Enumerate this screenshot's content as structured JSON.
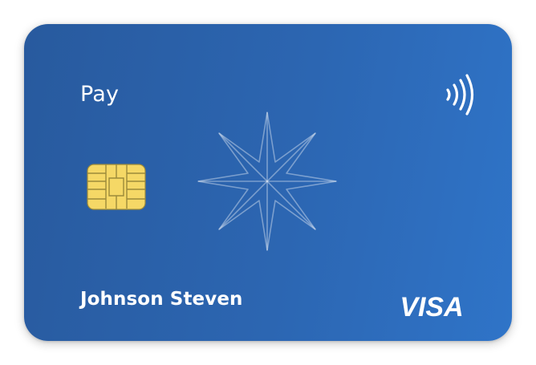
{
  "card": {
    "brand_label": "Pay",
    "holder_name": "Johnson Steven",
    "network": "VISA",
    "icons": {
      "contactless": "contactless-icon",
      "chip": "chip-icon",
      "emblem": "star-emblem-icon",
      "network_logo": "visa-logo"
    },
    "colors": {
      "card_start": "#285a9e",
      "card_end": "#2f74c8",
      "chip": "#f5d866",
      "text": "#ffffff"
    }
  }
}
